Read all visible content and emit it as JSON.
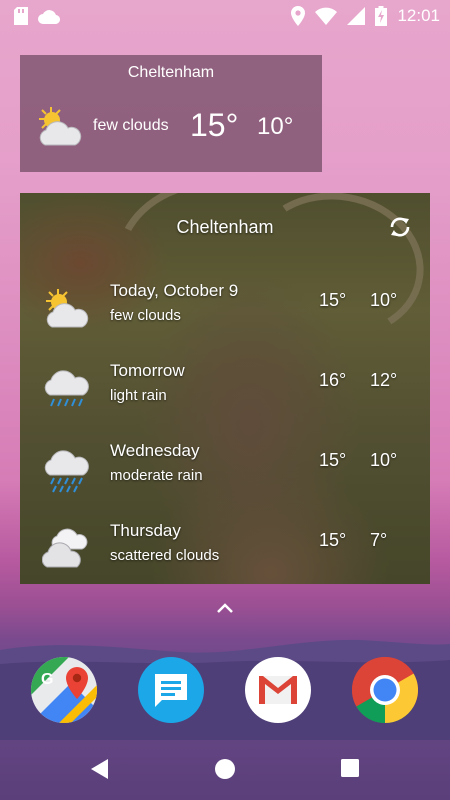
{
  "status_bar": {
    "left_icons": [
      "sd-card-icon",
      "weather-cloud-icon"
    ],
    "right_icons": [
      "location-icon",
      "wifi-icon",
      "signal-icon",
      "battery-charging-icon"
    ],
    "time": "12:01"
  },
  "small_widget": {
    "city": "Cheltenham",
    "icon": "few-clouds-icon",
    "description": "few clouds",
    "high": "15°",
    "low": "10°"
  },
  "forecast_widget": {
    "city": "Cheltenham",
    "refresh_icon": "refresh-icon",
    "rows": [
      {
        "day": "Today, October 9",
        "desc": "few clouds",
        "high": "15°",
        "low": "10°",
        "icon": "few-clouds-icon"
      },
      {
        "day": "Tomorrow",
        "desc": "light rain",
        "high": "16°",
        "low": "12°",
        "icon": "light-rain-icon"
      },
      {
        "day": "Wednesday",
        "desc": "moderate rain",
        "high": "15°",
        "low": "10°",
        "icon": "moderate-rain-icon"
      },
      {
        "day": "Thursday",
        "desc": "scattered clouds",
        "high": "15°",
        "low": "7°",
        "icon": "scattered-clouds-icon"
      }
    ]
  },
  "dock_apps": [
    {
      "name": "maps-app-icon"
    },
    {
      "name": "messages-app-icon"
    },
    {
      "name": "gmail-app-icon"
    },
    {
      "name": "chrome-app-icon"
    }
  ],
  "nav_buttons": [
    "back-icon",
    "home-icon",
    "recents-icon"
  ]
}
